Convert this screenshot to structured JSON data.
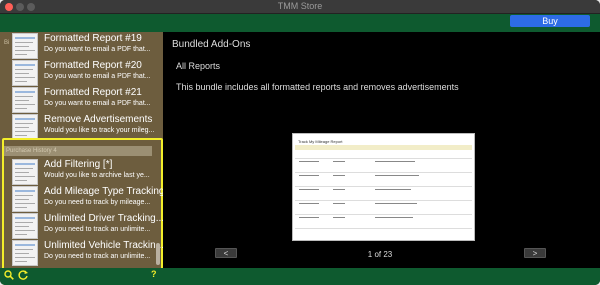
{
  "window": {
    "title": "TMM Store"
  },
  "header": {
    "buy_label": "Buy"
  },
  "sidebar": {
    "ghost_header": "Bi",
    "items": [
      {
        "title": "Formatted Report #19",
        "subtitle": "Do you want to email a PDF that..."
      },
      {
        "title": "Formatted Report #20",
        "subtitle": "Do you want to email a PDF that..."
      },
      {
        "title": "Formatted Report #21",
        "subtitle": "Do you want to email a PDF that..."
      },
      {
        "title": "Remove Advertisements",
        "subtitle": "Would you like to track your mileg..."
      }
    ],
    "purchase_history_label": "Purchase History 4",
    "purchase_history": [
      {
        "title": "Add Filtering [*]",
        "subtitle": "Would you like to archive last ye..."
      },
      {
        "title": "Add Mileage Type Tracking...",
        "subtitle": "Do you need to track by mileage..."
      },
      {
        "title": "Unlimited Driver Tracking...",
        "subtitle": "Do you need to track an unlimite..."
      },
      {
        "title": "Unlimited Vehicle Trackin...",
        "subtitle": "Do you need to track an unlimite..."
      }
    ],
    "help_label": "?"
  },
  "main": {
    "title": "Bundled Add-Ons",
    "subtitle": "All Reports",
    "description": "This bundle includes all formatted reports and removes advertisements",
    "preview_title": "Track My Mileage Report",
    "pager": {
      "prev": "<",
      "next": ">",
      "indicator": "1 of 23"
    }
  },
  "colors": {
    "accent_green": "#0e5a2f",
    "sidebar_brown": "#6d5d3e",
    "highlight_yellow": "#f3ee2a",
    "buy_blue": "#2d6ce6"
  }
}
